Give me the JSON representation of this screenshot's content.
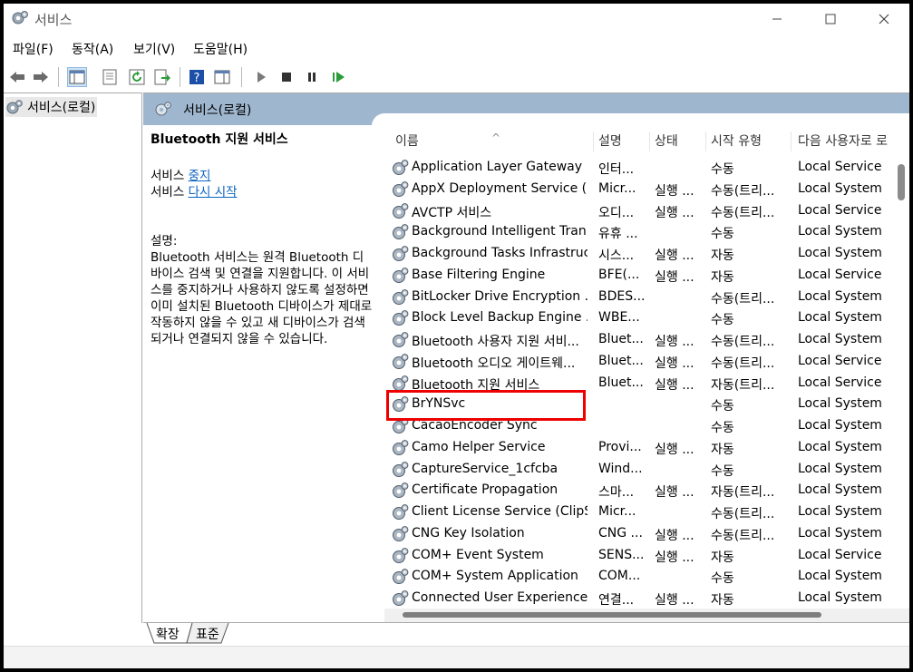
{
  "window": {
    "title": "서비스"
  },
  "menu": [
    "파일(F)",
    "동작(A)",
    "보기(V)",
    "도움말(H)"
  ],
  "tree": {
    "root_label": "서비스(로컬)"
  },
  "panel": {
    "header_title": "서비스(로컬)",
    "selected_service": "Bluetooth 지원 서비스",
    "action1_prefix": "서비스 ",
    "action1_link": "중지",
    "action2_prefix": "서비스 ",
    "action2_link": "다시 시작",
    "desc_label": "설명:",
    "desc_text": "Bluetooth 서비스는 원격 Bluetooth 디바이스 검색 및 연결을 지원합니다. 이 서비스를 중지하거나 사용하지 않도록 설정하면 이미 설치된 Bluetooth 디바이스가 제대로 작동하지 않을 수 있고 새 디바이스가 검색되거나 연결되지 않을 수 있습니다."
  },
  "columns": {
    "name": "이름",
    "desc": "설명",
    "status": "상태",
    "startup": "시작 유형",
    "logon": "다음 사용자로 로"
  },
  "services": [
    {
      "name": "Application Layer Gateway ...",
      "desc": "인터...",
      "status": "",
      "startup": "수동",
      "logon": "Local Service"
    },
    {
      "name": "AppX Deployment Service (...",
      "desc": "Micr...",
      "status": "실행 ...",
      "startup": "수동(트리...",
      "logon": "Local System"
    },
    {
      "name": "AVCTP 서비스",
      "desc": "오디...",
      "status": "실행 ...",
      "startup": "수동(트리...",
      "logon": "Local Service"
    },
    {
      "name": "Background Intelligent Tran...",
      "desc": "유휴 ...",
      "status": "",
      "startup": "수동",
      "logon": "Local System"
    },
    {
      "name": "Background Tasks Infrastruc...",
      "desc": "시스...",
      "status": "실행 ...",
      "startup": "자동",
      "logon": "Local System"
    },
    {
      "name": "Base Filtering Engine",
      "desc": "BFE(...",
      "status": "실행 ...",
      "startup": "자동",
      "logon": "Local Service"
    },
    {
      "name": "BitLocker Drive Encryption ...",
      "desc": "BDES...",
      "status": "",
      "startup": "수동(트리...",
      "logon": "Local System"
    },
    {
      "name": "Block Level Backup Engine ...",
      "desc": "WBE...",
      "status": "",
      "startup": "수동",
      "logon": "Local System"
    },
    {
      "name": "Bluetooth 사용자 지원 서비...",
      "desc": "Bluet...",
      "status": "실행 ...",
      "startup": "수동(트리...",
      "logon": "Local System"
    },
    {
      "name": "Bluetooth 오디오 게이트웨...",
      "desc": "Bluet...",
      "status": "실행 ...",
      "startup": "수동(트리...",
      "logon": "Local Service"
    },
    {
      "name": "Bluetooth 지원 서비스",
      "desc": "Bluet...",
      "status": "실행 ...",
      "startup": "자동(트리...",
      "logon": "Local Service"
    },
    {
      "name": "BrYNSvc",
      "desc": "",
      "status": "",
      "startup": "수동",
      "logon": "Local System"
    },
    {
      "name": "CacaoEncoder Sync",
      "desc": "",
      "status": "",
      "startup": "수동",
      "logon": "Local System"
    },
    {
      "name": "Camo Helper Service",
      "desc": "Provi...",
      "status": "실행 ...",
      "startup": "자동",
      "logon": "Local System"
    },
    {
      "name": "CaptureService_1cfcba",
      "desc": "Wind...",
      "status": "",
      "startup": "수동",
      "logon": "Local System"
    },
    {
      "name": "Certificate Propagation",
      "desc": "스마...",
      "status": "실행 ...",
      "startup": "자동(트리...",
      "logon": "Local System"
    },
    {
      "name": "Client License Service (ClipS...",
      "desc": "Micr...",
      "status": "",
      "startup": "수동(트리...",
      "logon": "Local System"
    },
    {
      "name": "CNG Key Isolation",
      "desc": "CNG ...",
      "status": "실행 ...",
      "startup": "수동(트리...",
      "logon": "Local System"
    },
    {
      "name": "COM+ Event System",
      "desc": "SENS...",
      "status": "실행 ...",
      "startup": "자동",
      "logon": "Local Service"
    },
    {
      "name": "COM+ System Application",
      "desc": "COM...",
      "status": "",
      "startup": "수동",
      "logon": "Local System"
    },
    {
      "name": "Connected User Experiences...",
      "desc": "연결...",
      "status": "실행 ...",
      "startup": "자동",
      "logon": "Local System"
    }
  ],
  "tabs": [
    "확장",
    "표준"
  ]
}
